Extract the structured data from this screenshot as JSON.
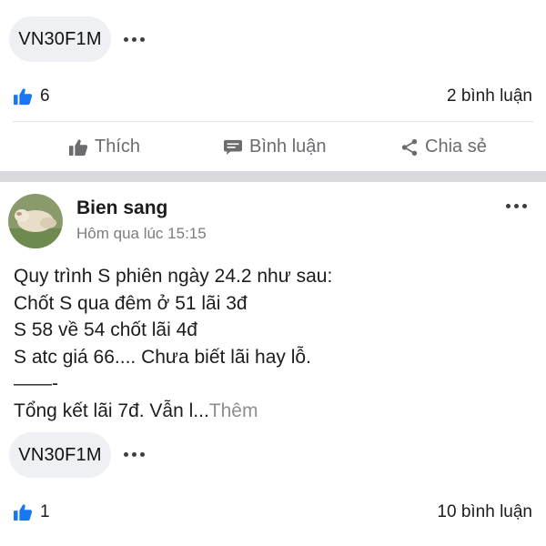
{
  "post1": {
    "tag": "VN30F1M",
    "likes": "6",
    "comments": "2 bình luận",
    "actions": {
      "like": "Thích",
      "comment": "Bình luận",
      "share": "Chia sẻ"
    }
  },
  "post2": {
    "author": "Bien sang",
    "time": "Hôm qua lúc 15:15",
    "content": {
      "line1": "Quy trình S phiên ngày 24.2 như sau:",
      "line2": "Chốt S qua đêm ở 51 lãi 3đ",
      "line3": "S 58 về 54 chốt lãi 4đ",
      "line4": "S atc giá 66.... Chưa biết lãi hay lỗ.",
      "line5": "——-",
      "line6": "Tổng kết lãi 7đ. Vẫn l...",
      "more": "Thêm"
    },
    "tag": "VN30F1M",
    "likes": "1",
    "comments": "10 bình luận"
  },
  "colors": {
    "like_blue": "#1877f2",
    "divider": "#e5e5ea",
    "chip_bg": "#eef0f3",
    "section_gap": "#d9d9de"
  },
  "icons": [
    "more-dots-icon",
    "thumbs-up-icon",
    "comment-icon",
    "share-icon"
  ]
}
